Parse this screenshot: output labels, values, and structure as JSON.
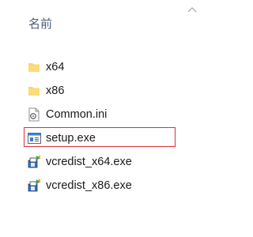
{
  "header": {
    "column_name": "名前",
    "sort_icon": "chevron-up-icon"
  },
  "files": [
    {
      "name": "x64",
      "icon": "folder-icon",
      "type": "folder"
    },
    {
      "name": "x86",
      "icon": "folder-icon",
      "type": "folder"
    },
    {
      "name": "Common.ini",
      "icon": "settings-file-icon",
      "type": "ini"
    },
    {
      "name": "setup.exe",
      "icon": "application-icon",
      "type": "exe",
      "highlighted": true
    },
    {
      "name": "vcredist_x64.exe",
      "icon": "installer-icon",
      "type": "exe"
    },
    {
      "name": "vcredist_x86.exe",
      "icon": "installer-icon",
      "type": "exe"
    }
  ],
  "colors": {
    "folder": "#f8d46a",
    "highlight_border": "#e0303a",
    "header_text": "#4c607a"
  }
}
